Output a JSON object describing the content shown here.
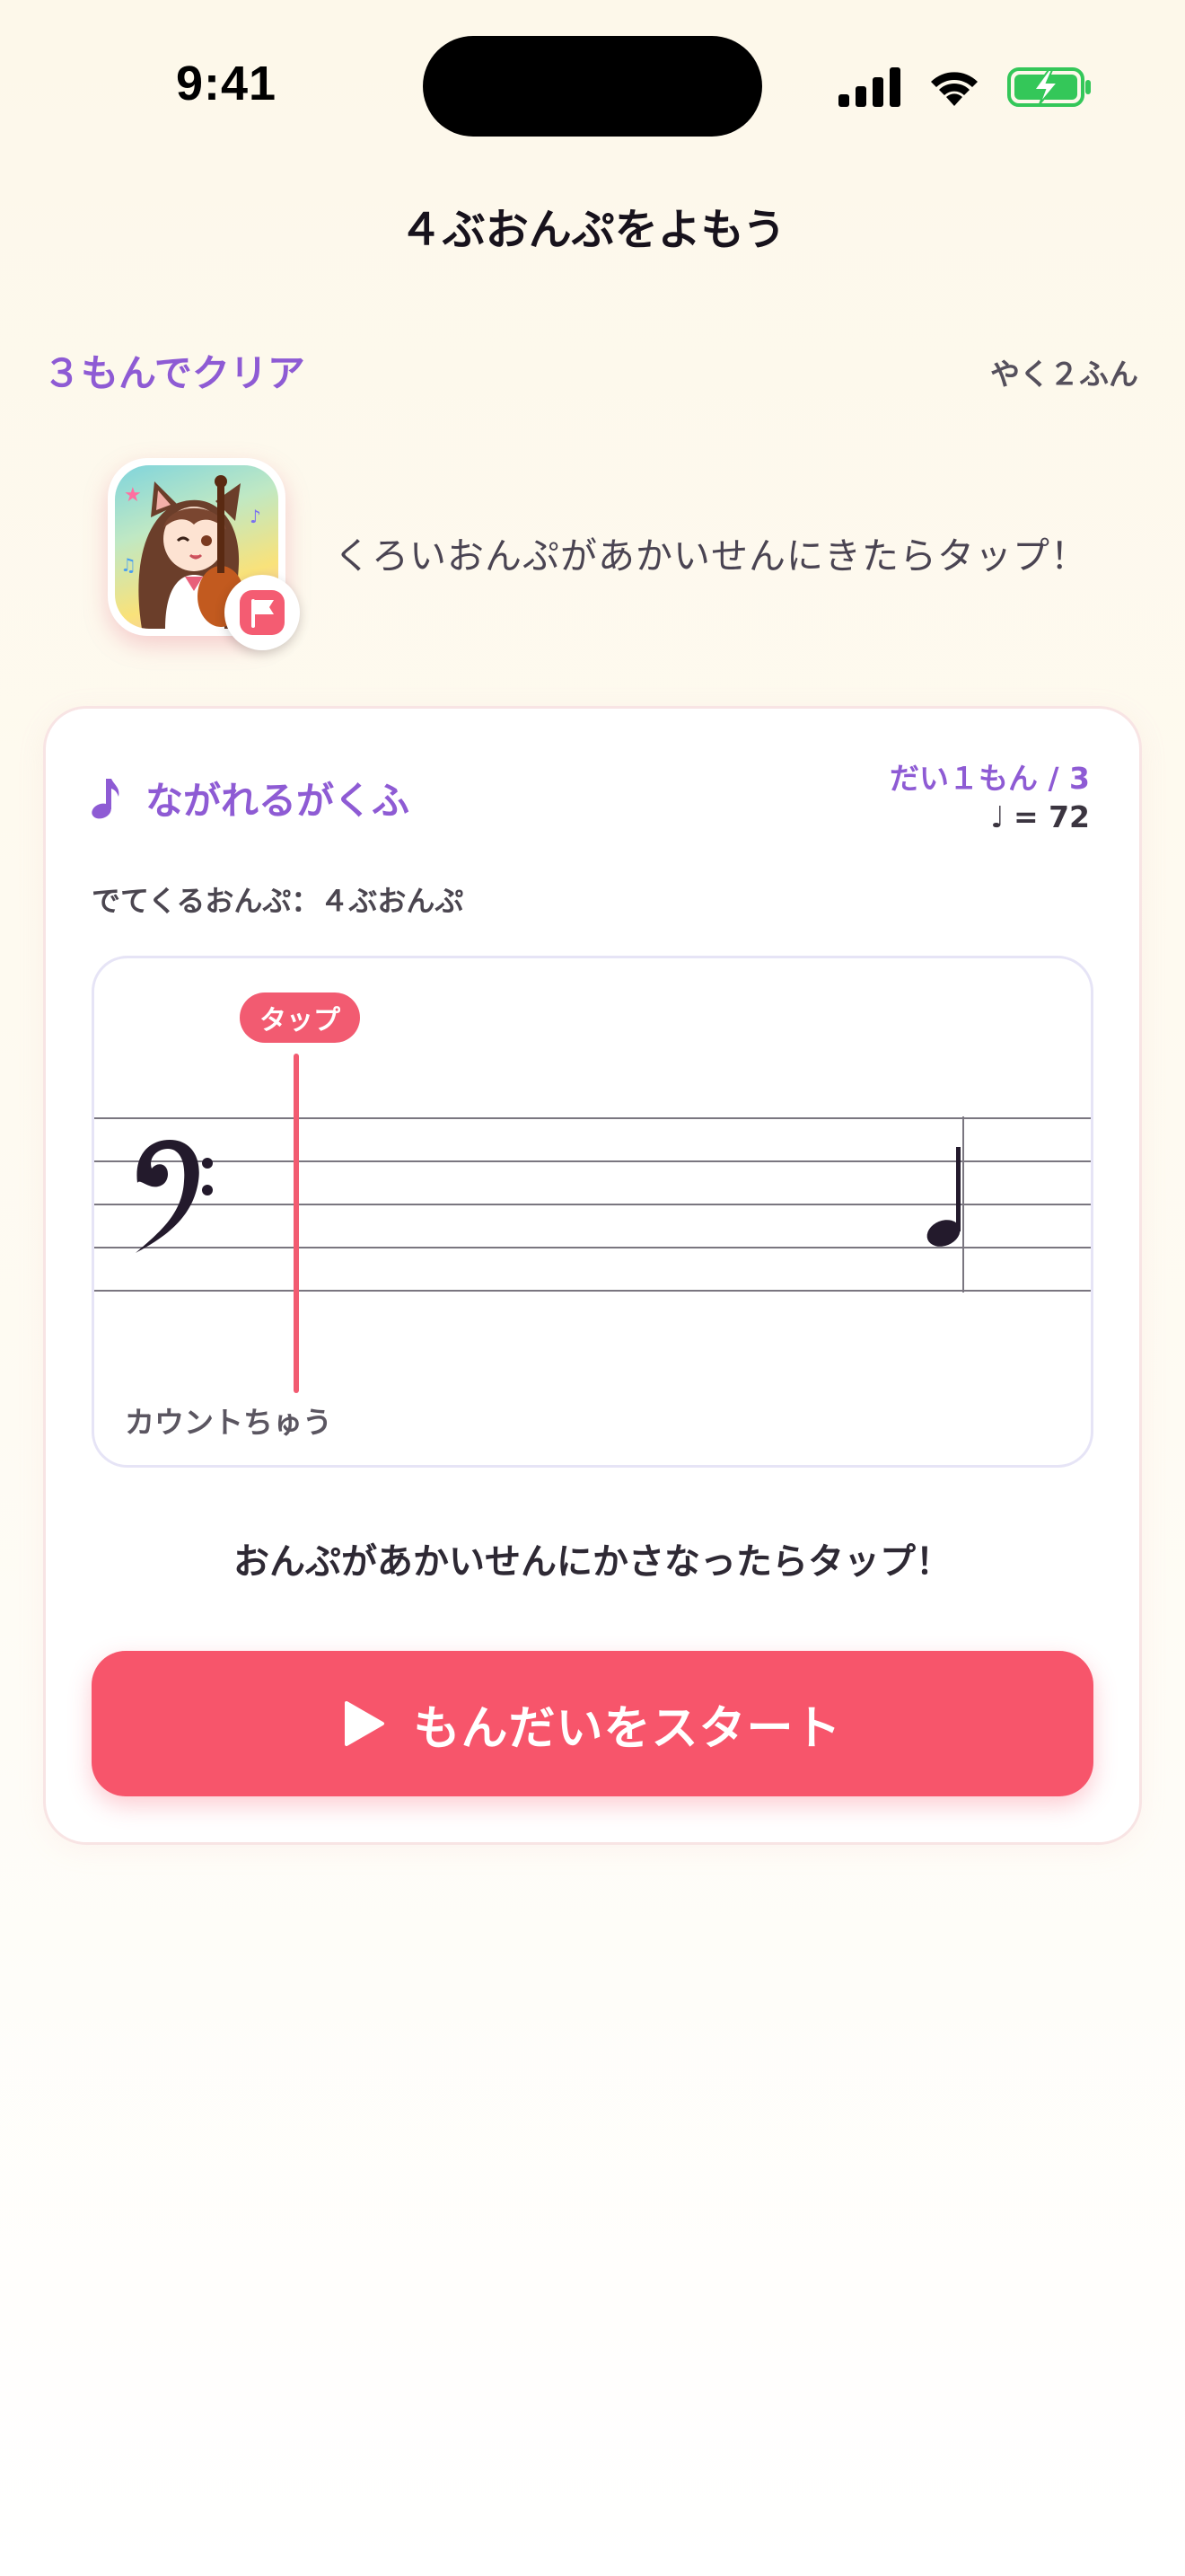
{
  "status_bar": {
    "time": "9:41"
  },
  "nav": {
    "title": "４ぶおんぷをよもう"
  },
  "header": {
    "goal": "３もんでクリア",
    "estimate": "やく２ふん"
  },
  "lesson": {
    "instruction": "くろいおんぷがあかいせんにきたらタップ！"
  },
  "card": {
    "title": "ながれるがくふ",
    "question_count": "だい１もん / 3",
    "tempo_symbol": "♩",
    "tempo_value": "= 72",
    "notes_label": "でてくるおんぷ：４ぶおんぷ",
    "tap_marker": "タップ",
    "count_status": "カウントちゅう",
    "tap_hint": "おんぷがあかいせんにかさなったらタップ！",
    "start_button": "もんだいをスタート"
  },
  "colors": {
    "accent_purple": "#8e5bd4",
    "tap_red": "#f25b71",
    "button_red": "#f7556b",
    "battery_green": "#34c759"
  },
  "icons": {
    "title_icon": "music-note-icon",
    "clef": "bass-clef-icon",
    "note": "quarter-note-icon",
    "start_icon": "play-icon",
    "badge": "flag-icon"
  }
}
